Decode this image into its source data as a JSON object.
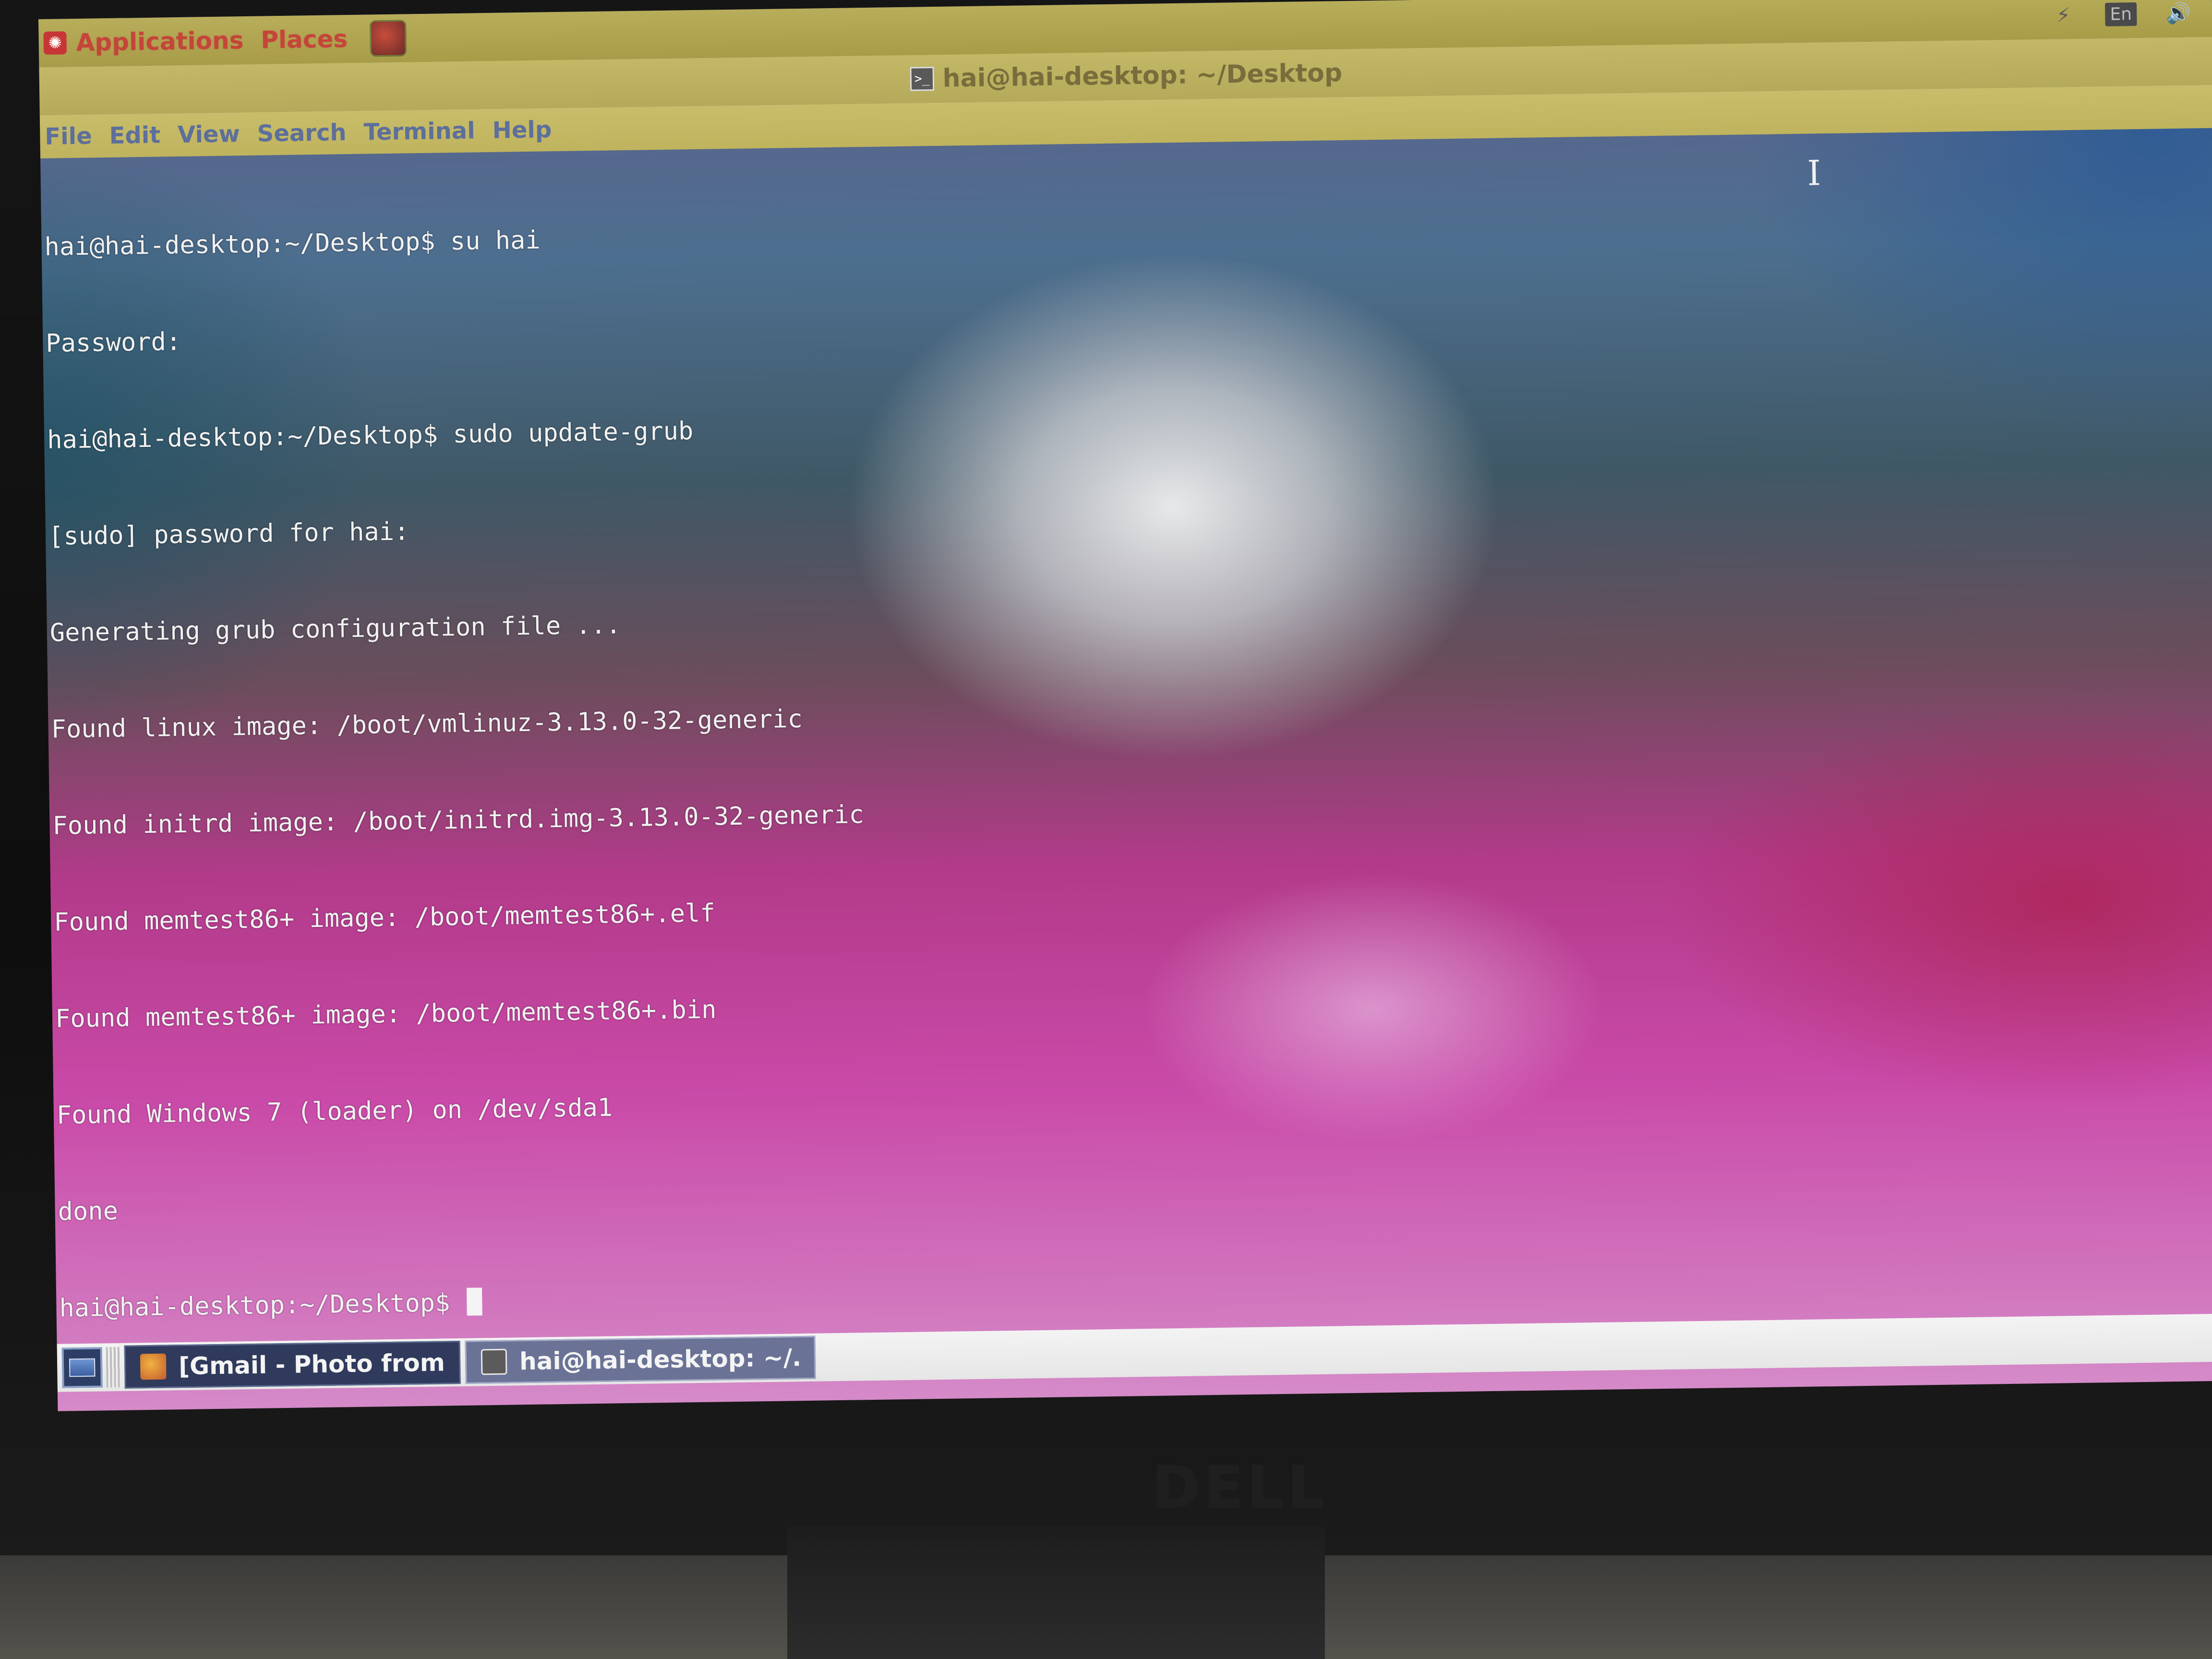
{
  "top_panel": {
    "applications_label": "Applications",
    "places_label": "Places",
    "language_indicator": "En",
    "icons": [
      "distro-logo-icon",
      "app-launcher-icon",
      "network-icon",
      "volume-icon"
    ]
  },
  "window": {
    "title": "hai@hai-desktop: ~/Desktop",
    "menu": [
      "File",
      "Edit",
      "View",
      "Search",
      "Terminal",
      "Help"
    ]
  },
  "terminal": {
    "lines": [
      "hai@hai-desktop:~/Desktop$ su hai",
      "Password:",
      "hai@hai-desktop:~/Desktop$ sudo update-grub",
      "[sudo] password for hai:",
      "Generating grub configuration file ...",
      "Found linux image: /boot/vmlinuz-3.13.0-32-generic",
      "Found initrd image: /boot/initrd.img-3.13.0-32-generic",
      "Found memtest86+ image: /boot/memtest86+.elf",
      "Found memtest86+ image: /boot/memtest86+.bin",
      "Found Windows 7 (loader) on /dev/sda1",
      "done"
    ],
    "prompt": "hai@hai-desktop:~/Desktop$ "
  },
  "taskbar": {
    "tasks": [
      {
        "label": "[Gmail - Photo from ...",
        "icon": "browser-icon"
      },
      {
        "label": "hai@hai-desktop: ~/...",
        "icon": "terminal-icon"
      }
    ]
  },
  "monitor": {
    "brand": "DELL"
  },
  "colors": {
    "panel": "#b8ad5a",
    "menu_text": "#5d6f9a",
    "panel_link": "#c4453a",
    "terminal_text": "#f2f2f2",
    "task_active": "#6a7296",
    "task_inactive": "#2f3a5c"
  }
}
